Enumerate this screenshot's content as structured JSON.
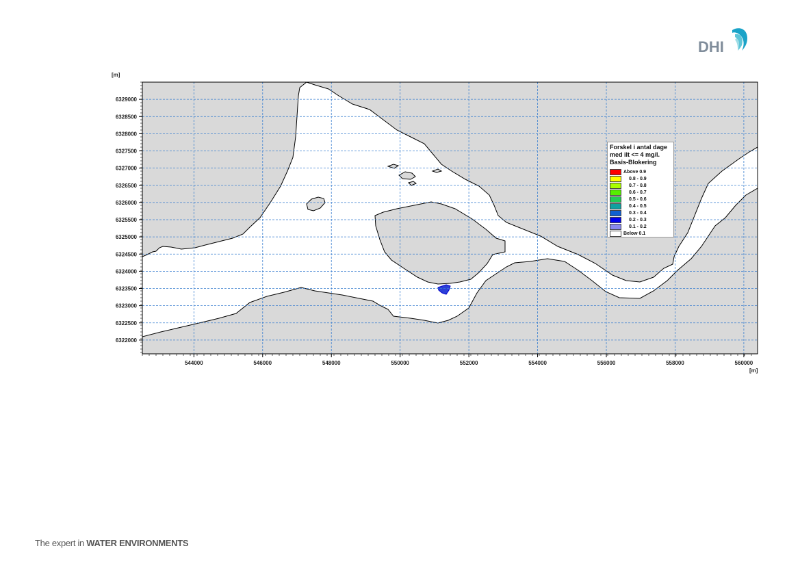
{
  "brand": {
    "logo_text": "DHI",
    "tagline_prefix": "The expert in ",
    "tagline_bold": "WATER ENVIRONMENTS",
    "colors": {
      "logo_text": "#7f8c9a",
      "logo_wave_1": "#1aa3c8",
      "logo_wave_2": "#5ec5d8",
      "logo_wave_3": "#9edde6"
    }
  },
  "map": {
    "x_unit": "[m]",
    "y_unit": "[m]",
    "x_ticks": [
      "544000",
      "546000",
      "548000",
      "550000",
      "552000",
      "554000",
      "556000",
      "558000",
      "560000"
    ],
    "y_ticks": [
      "6329000",
      "6328500",
      "6328000",
      "6327500",
      "6327000",
      "6326500",
      "6326000",
      "6325500",
      "6325000",
      "6324500",
      "6324000",
      "6323500",
      "6323000",
      "6322500",
      "6322000"
    ],
    "x_range": [
      542500,
      560400
    ],
    "y_range": [
      6321600,
      6329500
    ],
    "grid": true,
    "colors": {
      "land": "#d9d9d9",
      "water": "#ffffff",
      "grid": "#3a7fd0",
      "coast": "#000000"
    }
  },
  "legend": {
    "title": "Forskel i antal dage\nmed ilt <= 4 mg/l.\nBasis-Blokering",
    "placement": "upper-right",
    "items": [
      {
        "label": "Above 0.9",
        "color": "#ff0000"
      },
      {
        "label": "0.8 - 0.9",
        "color": "#ffff00"
      },
      {
        "label": "0.7 - 0.8",
        "color": "#aaff00"
      },
      {
        "label": "0.6 - 0.7",
        "color": "#55ee00"
      },
      {
        "label": "0.5 - 0.6",
        "color": "#22cc55"
      },
      {
        "label": "0.4 - 0.5",
        "color": "#11a0a0"
      },
      {
        "label": "0.3 - 0.4",
        "color": "#1060d0"
      },
      {
        "label": "0.2 - 0.3",
        "color": "#0000ee"
      },
      {
        "label": "0.1 - 0.2",
        "color": "#8888ee"
      },
      {
        "label": "Below 0.1",
        "color": "#ffffff"
      }
    ]
  }
}
